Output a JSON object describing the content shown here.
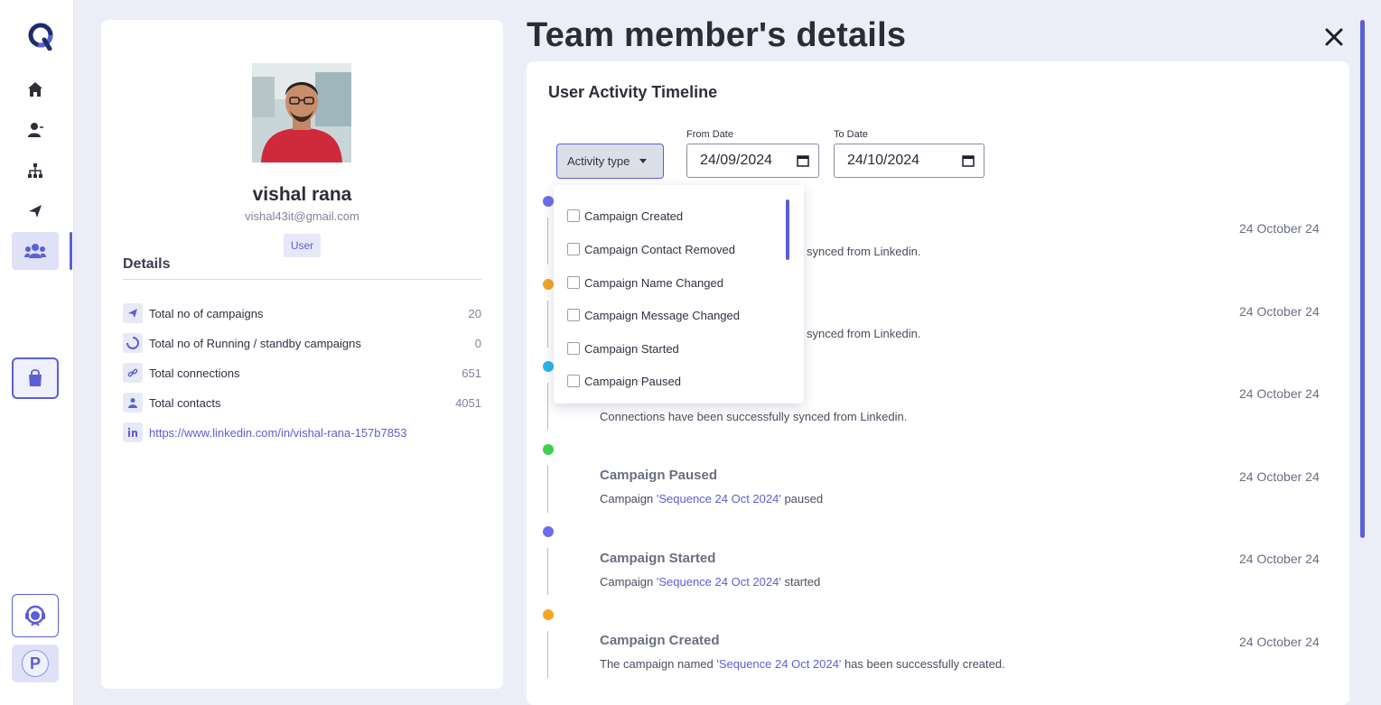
{
  "page": {
    "title": "Team member's details"
  },
  "nav": {
    "icons": [
      "logo-icon",
      "home-icon",
      "contacts-icon",
      "sitemap-icon",
      "plane-icon",
      "users-icon",
      "shopping-bag-icon",
      "support-icon"
    ],
    "profile_initial": "P",
    "accent": "#5b5fd6"
  },
  "profile": {
    "name": "vishal rana",
    "email": "vishal43it@gmail.com",
    "role": "User",
    "details_title": "Details",
    "stats": [
      {
        "label": "Total no of campaigns",
        "value": "20",
        "icon": "plane-icon"
      },
      {
        "label": "Total no of Running / standby campaigns",
        "value": "0",
        "icon": "spinner-icon"
      },
      {
        "label": "Total connections",
        "value": "651",
        "icon": "link-icon"
      },
      {
        "label": "Total contacts",
        "value": "4051",
        "icon": "user-icon"
      }
    ],
    "linkedin_url": "https://www.linkedin.com/in/vishal-rana-157b7853"
  },
  "timeline": {
    "title": "User Activity Timeline",
    "activity_type_label": "Activity type",
    "from_date_label": "From Date",
    "from_date_value": "24/09/2024",
    "to_date_label": "To Date",
    "to_date_value": "24/10/2024",
    "events": [
      {
        "title": "",
        "date": "24 October 24",
        "desc_suffix": "synced from Linkedin.",
        "color": "#6d6fe8"
      },
      {
        "title": "",
        "date": "24 October 24",
        "desc_suffix": "synced from Linkedin.",
        "color": "#f5a623"
      },
      {
        "title": "",
        "date": "24 October 24",
        "desc": "Connections have been successfully synced from Linkedin.",
        "color": "#29b6e8"
      },
      {
        "title": "Campaign Paused",
        "date": "24 October 24",
        "desc_prefix": "Campaign ",
        "desc_quote": "'Sequence 24 Oct 2024'",
        "desc_suffix": " paused",
        "color": "#3ecf4b"
      },
      {
        "title": "Campaign Started",
        "date": "24 October 24",
        "desc_prefix": "Campaign ",
        "desc_quote": "'Sequence 24 Oct 2024'",
        "desc_suffix": " started",
        "color": "#6d6fe8"
      },
      {
        "title": "Campaign Created",
        "date": "24 October 24",
        "desc_prefix": "The campaign named ",
        "desc_quote": "'Sequence 24 Oct 2024'",
        "desc_suffix": " has been successfully created.",
        "color": "#f5a623"
      }
    ]
  },
  "dropdown": {
    "options": [
      "Campaign Created",
      "Campaign Contact Removed",
      "Campaign Name Changed",
      "Campaign Message Changed",
      "Campaign Started",
      "Campaign Paused"
    ]
  }
}
